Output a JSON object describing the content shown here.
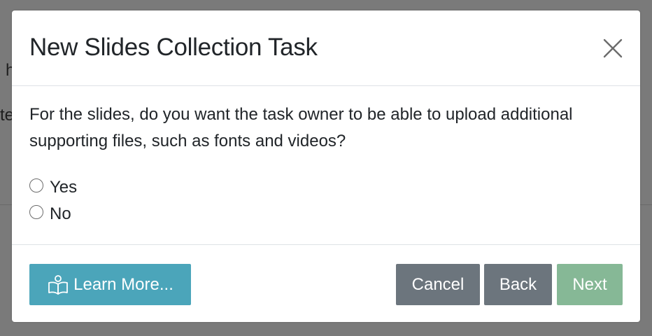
{
  "background": {
    "fragment_1": "h",
    "fragment_2": "te"
  },
  "modal": {
    "title": "New Slides Collection Task",
    "question": "For the slides, do you want the task owner to be able to upload additional supporting files, such as fonts and videos?",
    "options": [
      {
        "label": "Yes",
        "selected": false
      },
      {
        "label": "No",
        "selected": false
      }
    ]
  },
  "footer": {
    "learn_more_label": "Learn More...",
    "cancel_label": "Cancel",
    "back_label": "Back",
    "next_label": "Next"
  },
  "icons": {
    "close": "close-icon",
    "learn_more": "book-reader-icon"
  },
  "colors": {
    "learn_more": "#4ba5ba",
    "secondary": "#6c757d",
    "next_disabled": "#86b896",
    "backdrop": "#7a7a7a"
  }
}
